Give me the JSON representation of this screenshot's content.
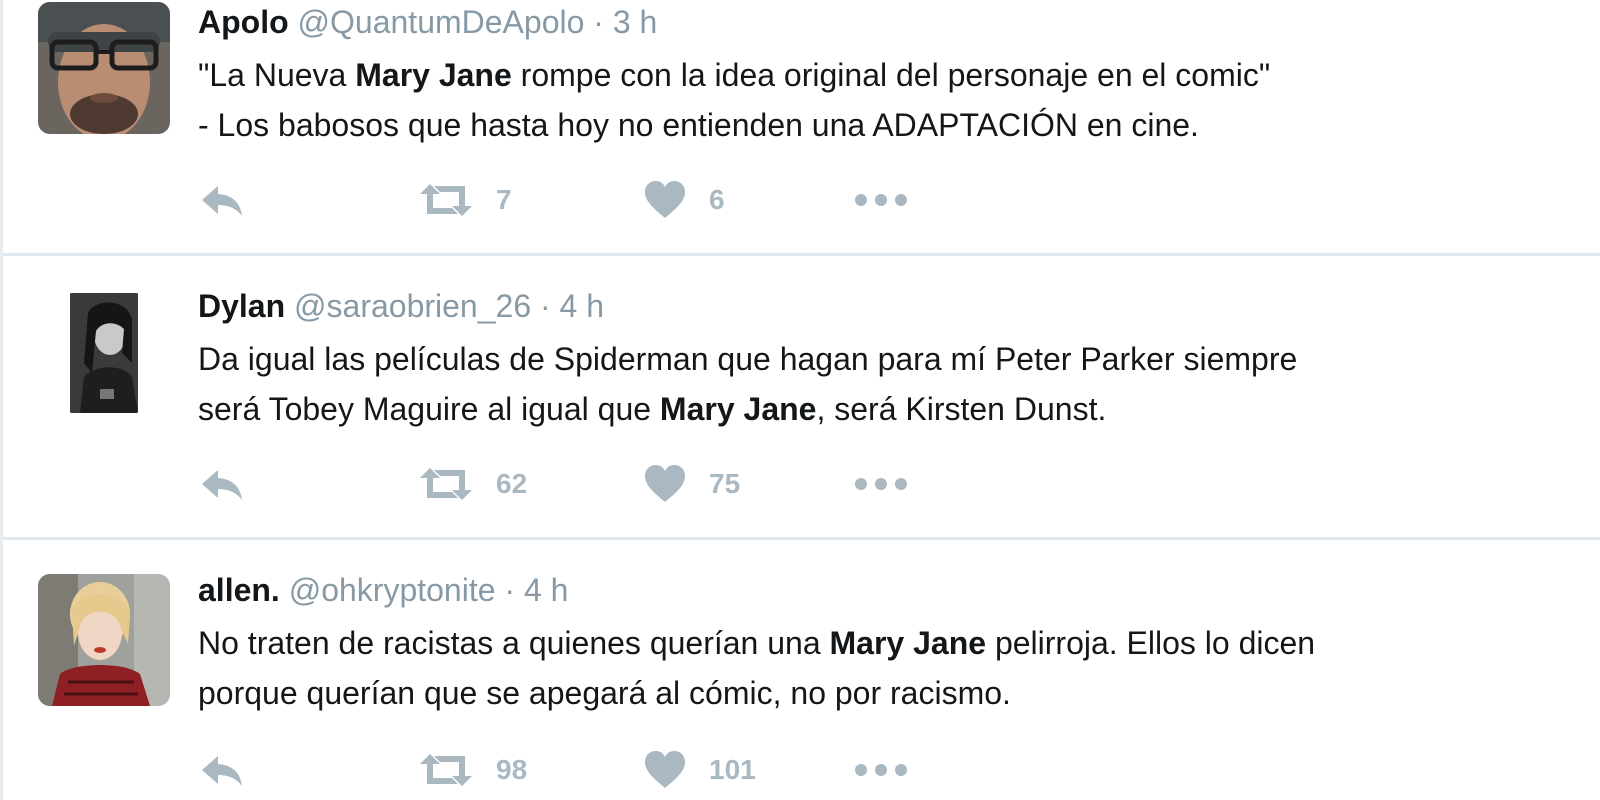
{
  "tweets": [
    {
      "name": "Apolo",
      "handle": "@QuantumDeApolo",
      "separator": "·",
      "time": "3 h",
      "line1": [
        {
          "text": "\"La Nueva ",
          "bold": false
        },
        {
          "text": "Mary Jane",
          "bold": true
        },
        {
          "text": " rompe con la idea original del personaje en el comic\"",
          "bold": false
        }
      ],
      "line2": [
        {
          "text": " - Los babosos que hasta hoy no entienden una ADAPTACIÓN en cine.",
          "bold": false
        }
      ],
      "retweets": "7",
      "likes": "6"
    },
    {
      "name": "Dylan",
      "handle": "@saraobrien_26",
      "separator": "·",
      "time": "4 h",
      "line1": [
        {
          "text": "Da igual las películas de Spiderman que hagan para mí Peter Parker siempre",
          "bold": false
        }
      ],
      "line2": [
        {
          "text": "será Tobey Maguire al igual que ",
          "bold": false
        },
        {
          "text": "Mary Jane",
          "bold": true
        },
        {
          "text": ", será Kirsten Dunst.",
          "bold": false
        }
      ],
      "retweets": "62",
      "likes": "75"
    },
    {
      "name": "allen.",
      "handle": "@ohkryptonite",
      "separator": "·",
      "time": "4 h",
      "line1": [
        {
          "text": "No traten de racistas a quienes querían una ",
          "bold": false
        },
        {
          "text": "Mary Jane",
          "bold": true
        },
        {
          "text": " pelirroja. Ellos lo dicen",
          "bold": false
        }
      ],
      "line2": [
        {
          "text": "porque querían que se apegará al cómic, no por racismo.",
          "bold": false
        }
      ],
      "retweets": "98",
      "likes": "101"
    }
  ],
  "colors": {
    "text": "#14171a",
    "muted": "#8899a6",
    "icon": "#aab8c2",
    "divider": "#e1e8ed"
  },
  "icons": {
    "reply": "reply-icon",
    "retweet": "retweet-icon",
    "like": "heart-icon",
    "more": "more-icon"
  }
}
